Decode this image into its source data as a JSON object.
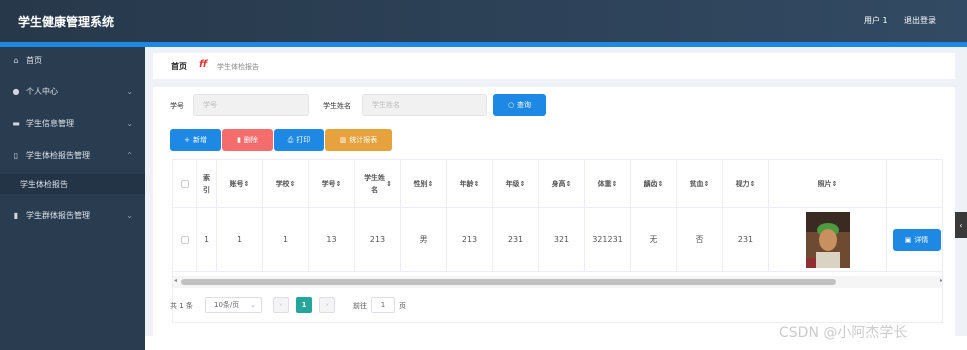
{
  "header": {
    "title": "学生健康管理系统",
    "user": "用户 1",
    "logout": "退出登录"
  },
  "sidebar": {
    "items": [
      {
        "label": "首页",
        "icon": "home-icon",
        "glyph": "⌂",
        "arrow": ""
      },
      {
        "label": "个人中心",
        "icon": "user-icon",
        "glyph": "●",
        "arrow": "⌄"
      },
      {
        "label": "学生信息管理",
        "icon": "id-card-icon",
        "glyph": "▬",
        "arrow": "⌄"
      },
      {
        "label": "学生体检报告管理",
        "icon": "phone-icon",
        "glyph": "▯",
        "arrow": "⌃"
      },
      {
        "label": "学生体检报告",
        "icon": "",
        "glyph": "",
        "arrow": ""
      },
      {
        "label": "学生群体报告管理",
        "icon": "trash-icon",
        "glyph": "▮",
        "arrow": "⌄"
      }
    ]
  },
  "breadcrumb": {
    "home": "首页",
    "current": "学生体检报告",
    "logo": "ff"
  },
  "search": {
    "student_no_label": "学号",
    "student_no_placeholder": "学号",
    "student_name_label": "学生姓名",
    "student_name_placeholder": "学生姓名",
    "button": "查询"
  },
  "actions": {
    "add": "新增",
    "delete": "删除",
    "print": "打印",
    "stats": "统计报表"
  },
  "table": {
    "headers": [
      "",
      "索引",
      "账号",
      "学校",
      "学号",
      "学生姓名",
      "性别",
      "年龄",
      "年级",
      "身高",
      "体重",
      "龋齿",
      "贫血",
      "视力",
      "照片",
      ""
    ],
    "row": [
      "",
      "1",
      "1",
      "1",
      "13",
      "213",
      "男",
      "213",
      "231",
      "321",
      "321231",
      "无",
      "否",
      "231",
      "",
      ""
    ],
    "detail_button": "详情"
  },
  "pagination": {
    "total": "共 1 条",
    "page_size": "10条/页",
    "current_page": "1",
    "goto": "前往",
    "goto_value": "1",
    "page_unit": "页"
  },
  "watermark": "CSDN @小阿杰学长",
  "colors": {
    "primary": "#1e88e5",
    "danger": "#f56c6c",
    "warning": "#e6a23c",
    "active_page": "#26a69a"
  }
}
